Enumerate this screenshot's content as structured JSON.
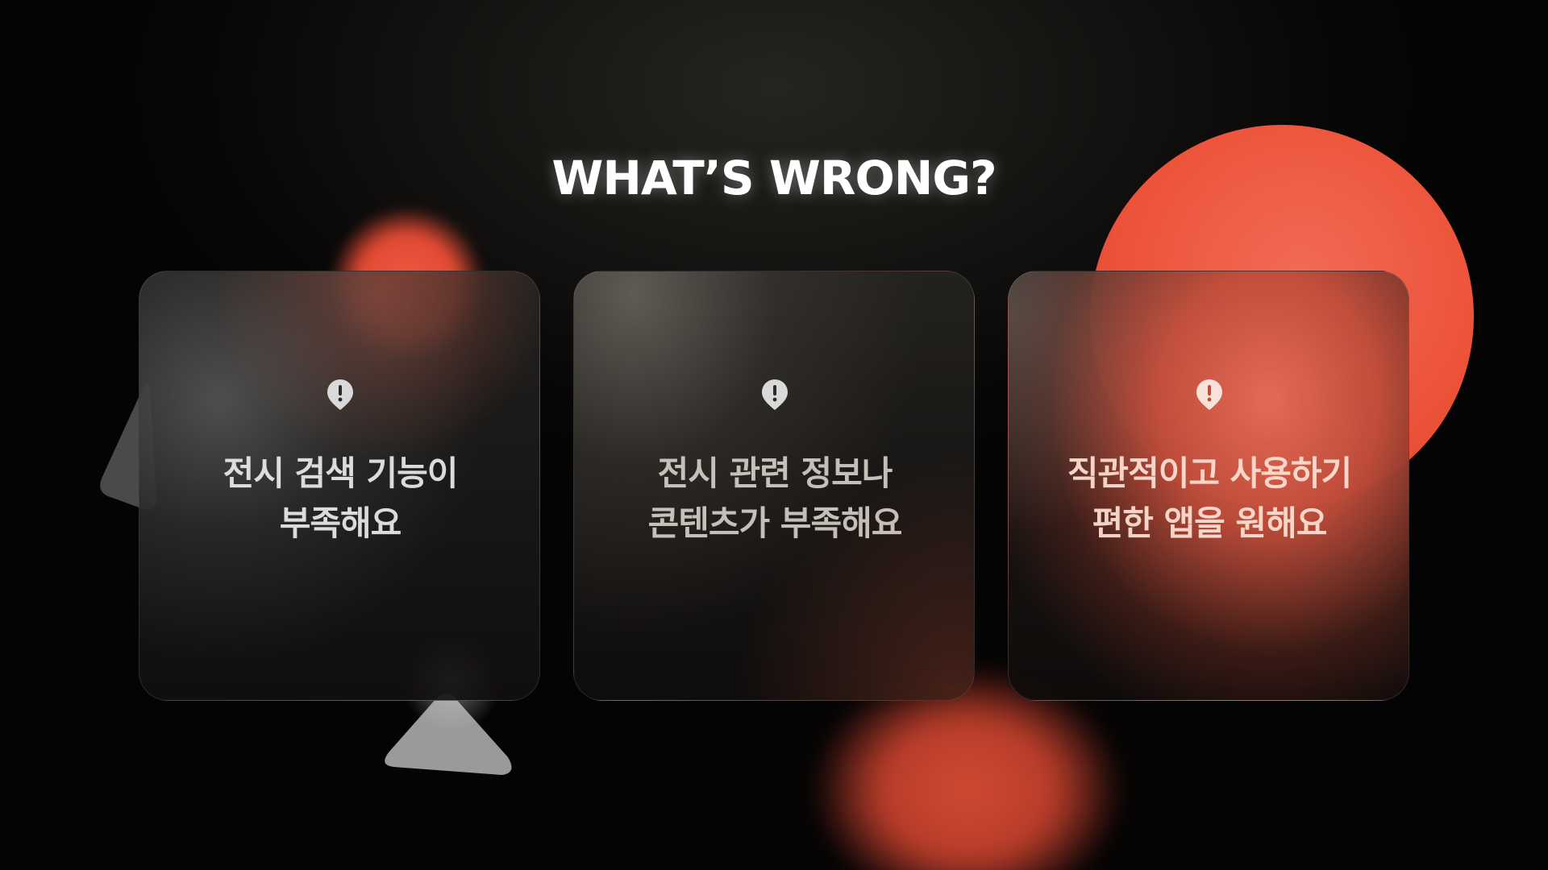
{
  "page": {
    "title": "WHAT’S WRONG?"
  },
  "colors": {
    "background": "#050404",
    "accent_red": "#ec5238",
    "text_white": "#ffffff"
  },
  "cards": [
    {
      "icon": "alert-pin-icon",
      "lines": [
        "전시 검색 기능이",
        "부족해요"
      ]
    },
    {
      "icon": "alert-pin-icon",
      "lines": [
        "전시 관련 정보나",
        "콘텐츠가 부족해요"
      ]
    },
    {
      "icon": "alert-pin-icon",
      "lines": [
        "직관적이고 사용하기",
        "편한 앱을 원해요"
      ]
    }
  ]
}
